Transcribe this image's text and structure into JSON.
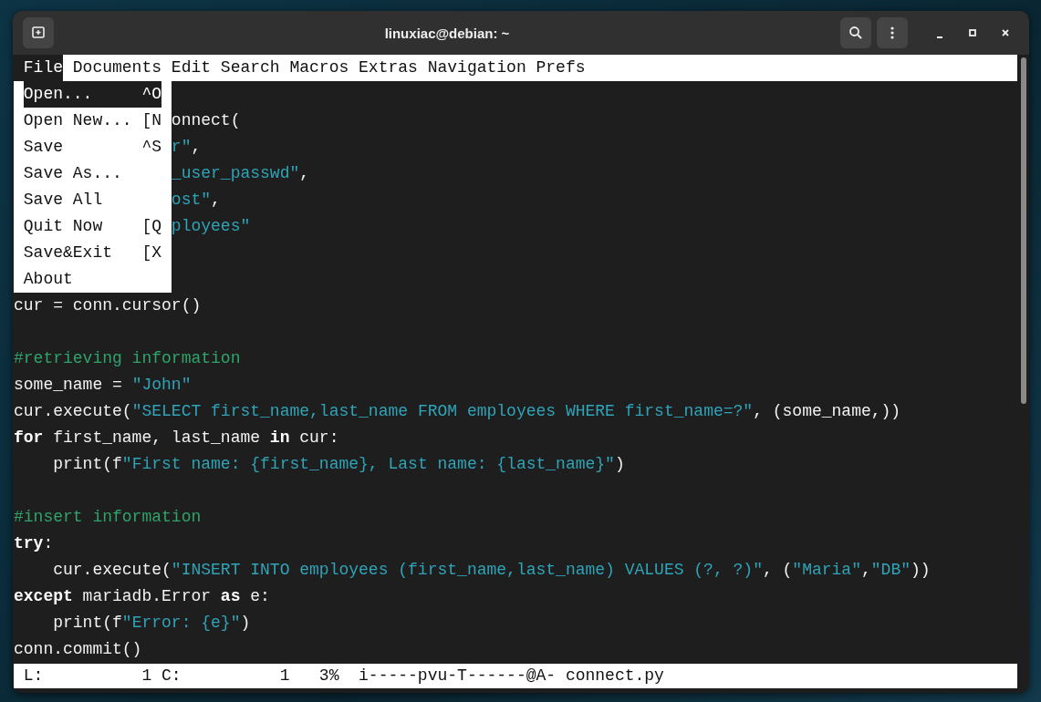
{
  "window": {
    "title": "linuxiac@debian: ~"
  },
  "menu_bar": [
    {
      "label": "File",
      "selected": true
    },
    {
      "label": "Documents",
      "selected": false
    },
    {
      "label": "Edit",
      "selected": false
    },
    {
      "label": "Search",
      "selected": false
    },
    {
      "label": "Macros",
      "selected": false
    },
    {
      "label": "Extras",
      "selected": false
    },
    {
      "label": "Navigation",
      "selected": false
    },
    {
      "label": "Prefs",
      "selected": false
    }
  ],
  "file_menu": [
    {
      "label": "Open...",
      "shortcut": "^O",
      "selected": true
    },
    {
      "label": "Open New...",
      "shortcut": "[N",
      "selected": false
    },
    {
      "label": "Save",
      "shortcut": "^S",
      "selected": false
    },
    {
      "label": "Save As...",
      "selected": false
    },
    {
      "label": "Save All",
      "selected": false
    },
    {
      "label": "Quit Now",
      "shortcut": "[Q",
      "selected": false
    },
    {
      "label": "Save&Exit",
      "shortcut": "[X",
      "selected": false
    },
    {
      "label": "About",
      "selected": false
    }
  ],
  "code_lines": [
    {
      "clipped": true,
      "follows_blank": true,
      "segments": [
        {
          "kind": "plain",
          "text": "onnect("
        }
      ]
    },
    {
      "clipped": true,
      "segments": [
        {
          "kind": "string",
          "text": "r\""
        },
        {
          "kind": "plain",
          "text": ","
        }
      ]
    },
    {
      "clipped": true,
      "segments": [
        {
          "kind": "string",
          "text": "_user_passwd\""
        },
        {
          "kind": "plain",
          "text": ","
        }
      ]
    },
    {
      "clipped": true,
      "segments": [
        {
          "kind": "string",
          "text": "ost\""
        },
        {
          "kind": "plain",
          "text": ","
        }
      ]
    },
    {
      "clipped": true,
      "segments": [
        {
          "kind": "string",
          "text": "ployees\""
        }
      ]
    },
    {
      "segments": [
        {
          "kind": "plain",
          "text": "cur = conn.cursor()"
        }
      ]
    },
    {
      "follows_blank": true,
      "segments": [
        {
          "kind": "comment",
          "text": "#retrieving information"
        }
      ]
    },
    {
      "segments": [
        {
          "kind": "plain",
          "text": "some_name = "
        },
        {
          "kind": "string",
          "text": "\"John\""
        }
      ]
    },
    {
      "segments": [
        {
          "kind": "plain",
          "text": "cur.execute("
        },
        {
          "kind": "string",
          "text": "\"SELECT first_name,last_name FROM employees WHERE first_name=?\""
        },
        {
          "kind": "plain",
          "text": ", (some_name,))"
        }
      ]
    },
    {
      "segments": [
        {
          "kind": "keyword",
          "text": "for"
        },
        {
          "kind": "plain",
          "text": " first_name, last_name "
        },
        {
          "kind": "keyword",
          "text": "in"
        },
        {
          "kind": "plain",
          "text": " cur:"
        }
      ]
    },
    {
      "indented": true,
      "segments": [
        {
          "kind": "plain",
          "text": "print(f"
        },
        {
          "kind": "string",
          "text": "\"First name: {first_name}, Last name: {last_name}\""
        },
        {
          "kind": "plain",
          "text": ")"
        }
      ]
    },
    {
      "follows_blank": true,
      "segments": [
        {
          "kind": "comment",
          "text": "#insert information"
        }
      ]
    },
    {
      "segments": [
        {
          "kind": "keyword",
          "text": "try"
        },
        {
          "kind": "plain",
          "text": ":"
        }
      ]
    },
    {
      "indented": true,
      "segments": [
        {
          "kind": "plain",
          "text": "cur.execute("
        },
        {
          "kind": "string",
          "text": "\"INSERT INTO employees (first_name,last_name) VALUES (?, ?)\""
        },
        {
          "kind": "plain",
          "text": ", ("
        },
        {
          "kind": "string",
          "text": "\"Maria\""
        },
        {
          "kind": "plain",
          "text": ","
        },
        {
          "kind": "string",
          "text": "\"DB\""
        },
        {
          "kind": "plain",
          "text": "))"
        }
      ]
    },
    {
      "segments": [
        {
          "kind": "keyword",
          "text": "except"
        },
        {
          "kind": "plain",
          "text": " mariadb.Error "
        },
        {
          "kind": "keyword",
          "text": "as"
        },
        {
          "kind": "plain",
          "text": " e:"
        }
      ]
    },
    {
      "indented": true,
      "segments": [
        {
          "kind": "plain",
          "text": "print(f"
        },
        {
          "kind": "string",
          "text": "\"Error: {e}\""
        },
        {
          "kind": "plain",
          "text": ")"
        }
      ]
    },
    {
      "segments": [
        {
          "kind": "plain",
          "text": "conn.commit()"
        }
      ]
    }
  ],
  "status_bar": "L:          1 C:          1   3%  i-----pvu-T------@A- connect.py"
}
